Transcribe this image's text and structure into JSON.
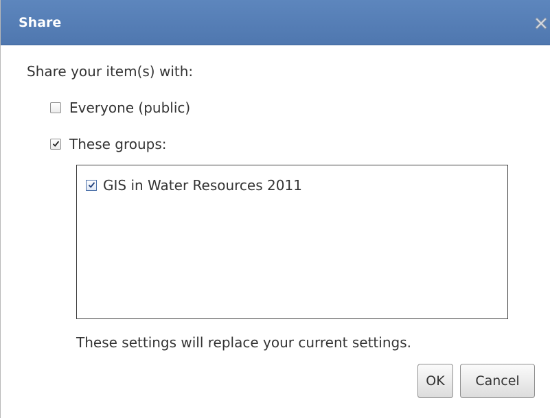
{
  "dialog": {
    "title": "Share",
    "close_icon": "close-icon"
  },
  "share": {
    "prompt": "Share your item(s) with:",
    "options": [
      {
        "label": "Everyone (public)",
        "checked": false
      },
      {
        "label": "These groups:",
        "checked": true
      }
    ],
    "groups": [
      {
        "label": "GIS in Water Resources 2011",
        "checked": true
      }
    ],
    "note": "These settings will replace your current settings."
  },
  "buttons": {
    "ok_label": "OK",
    "cancel_label": "Cancel"
  },
  "colors": {
    "titlebar": "#5581b9",
    "text": "#333333"
  }
}
